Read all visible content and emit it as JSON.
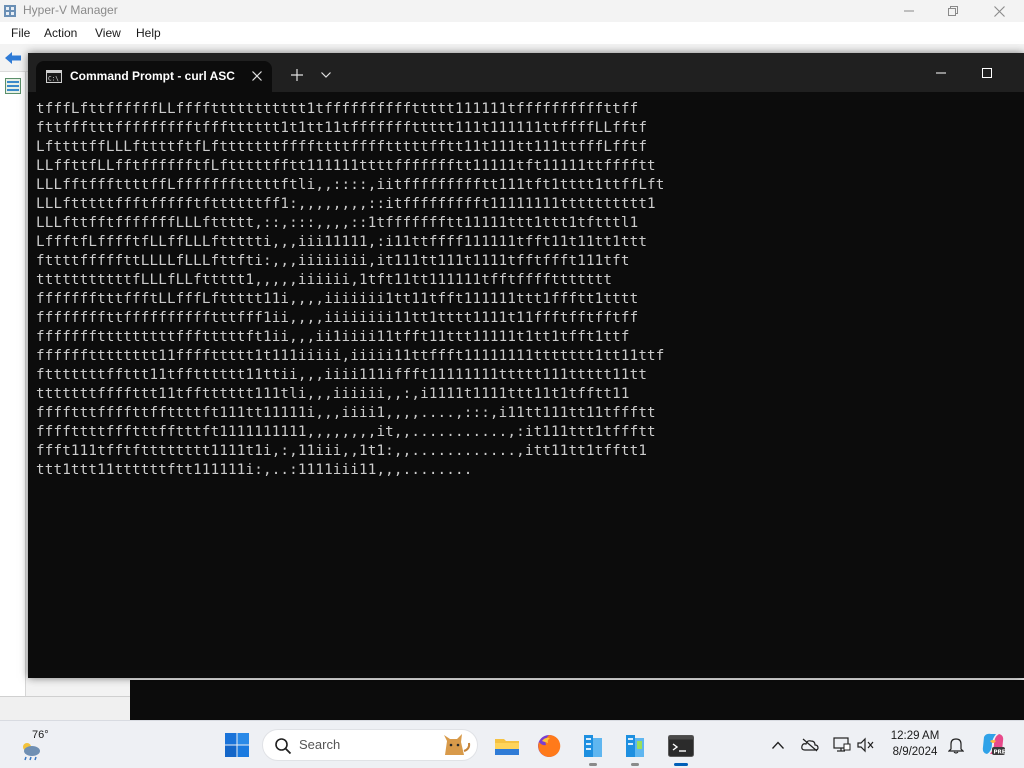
{
  "hyperv": {
    "title": "Hyper-V Manager",
    "menu": [
      "File",
      "Action",
      "View",
      "Help"
    ]
  },
  "cmd": {
    "tab_title": "Command Prompt - curl  ASC",
    "close_glyph": "✕",
    "newtab_glyph": "+",
    "lines": [
      "tfffLfttffffffLLffffttttttttttt1tffffffffffttttt111111tffffffffffttff",
      "fttffftttffffffffftffftttttt1t1tt11tfffffffttttt111t111111ttffffLLfftf",
      "LfttttffLLLfttttftfLftttttttffffttttfffftttttfftt11t111tt111ttfffLfftf",
      "LLffttfLLfftfffffftfLftttttfftt111111ttttffffffftt11111tft11111ttfffftt",
      "LLLfftfffttttffLffffffftttttftli,,::::,iitffffffffftt111tft1tttt1ttffLft",
      "LLLftttttffftffffftfttttttff1:,,,,,,,,::itffffffffft11111111tttttttttt1",
      "LLLfttfftfffffffLLLfttttt,::,:::,,,,::1tffffffftt11111ttt1ttt1tftttl1",
      "LffftfLfffftfLLffLLLfttttti,,,iii11111,:i11ttffff111111tfft11t11tt1ttt",
      "fttttfffffttLLLLfLLLfttfti:,,,iiiiiiii,it111tt111t1111tfftffft111tft",
      "tttttttttttfLLLfLLfttttt1,,,,,iiiiii,1tft11tt111111tfftffffttttttt",
      "ffffffftttffftLLfffLfttttt11i,,,,iiiiiii1tt11tfft111111ttt1ffftt1tttt",
      "ffffffffttfffffffffftttfff1ii,,,,iiiiiiii11tt1tttt1111t11ffftfftfftff",
      "ffffffftttttttttffftttttft1ii,,,ii1iiii11tfft11ttt11111t1tt1tfft1ttf",
      "fffffftttttttt11ffffttttt1t111iiiii,iiiii11ttffft11111111ttttttt1tt11ttf",
      "ftttttttffttt11tfftttttt11ttii,,,iiii111iffft11111111ttttt111ttttt11tt",
      "tttttttffffttt11tfftttttt111tli,,,iiiiii,,:,i1111t1111ttt11t1tfftt11",
      "fffftttffffttffttttft111tt11111i,,,iiii1,,,,....,:::,i11tt111tt11tffftt",
      "ffffttttffftttfftttft1111111111,,,,,,,,it,,...........,:it111ttt1tffftt",
      "ffft111tfftftttttttt1111t1i,:,11iii,,1t1:,,............,itt11tt1tfftt1",
      "ttt1ttt11ttttttftt111111i:,..:1111iii11,,,........"
    ]
  },
  "taskbar": {
    "weather_temp": "76°",
    "search_placeholder": "Search",
    "clock_time": "12:29 AM",
    "clock_date": "8/9/2024"
  },
  "colors": {
    "cmd_bg": "#0c0c0c",
    "cmd_text": "#cccccc",
    "tabbar_bg": "#202020",
    "taskbar_bg": "#eef0f4",
    "accent": "#005fb8"
  }
}
